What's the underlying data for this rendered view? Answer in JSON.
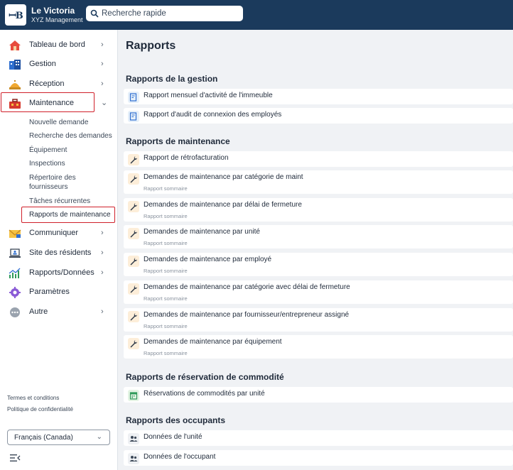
{
  "header": {
    "logo_text": "ꟷB",
    "brand_title": "Le Victoria",
    "brand_subtitle": "XYZ Management",
    "search_placeholder": "Recherche rapide"
  },
  "sidebar": {
    "items": [
      {
        "label": "Tableau de bord",
        "icon": "house-icon"
      },
      {
        "label": "Gestion",
        "icon": "building-icon"
      },
      {
        "label": "Réception",
        "icon": "service-bell-icon"
      },
      {
        "label": "Maintenance",
        "icon": "toolbox-icon"
      },
      {
        "label": "Communiquer",
        "icon": "envelope-icon"
      },
      {
        "label": "Site des résidents",
        "icon": "laptop-icon"
      },
      {
        "label": "Rapports/Données",
        "icon": "chart-icon"
      },
      {
        "label": "Paramètres",
        "icon": "gear-icon"
      },
      {
        "label": "Autre",
        "icon": "more-icon"
      }
    ],
    "maintenance_sub": [
      "Nouvelle demande",
      "Recherche des demandes",
      "Équipement",
      "Inspections",
      "Répertoire des fournisseurs",
      "Tâches récurrentes",
      "Rapports de maintenance"
    ],
    "footer": {
      "terms": "Termes et conditions",
      "privacy": "Politique de confidentialité",
      "language": "Français (Canada)"
    }
  },
  "main": {
    "title": "Rapports",
    "sections": [
      {
        "title": "Rapports de la gestion"
      },
      {
        "title": "Rapports de maintenance"
      },
      {
        "title": "Rapports de réservation de commodité"
      },
      {
        "title": "Rapports des occupants"
      }
    ],
    "reports": {
      "gestion": [
        "Rapport mensuel d'activité de l'immeuble",
        "Rapport d'audit de connexion des employés"
      ],
      "maintenance": [
        {
          "label": "Rapport de rétrofacturation",
          "sub": ""
        },
        {
          "label": "Demandes de maintenance par catégorie de maint",
          "sub": "Rapport sommaire"
        },
        {
          "label": "Demandes de maintenance par délai de fermeture",
          "sub": "Rapport sommaire"
        },
        {
          "label": "Demandes de maintenance par unité",
          "sub": "Rapport sommaire"
        },
        {
          "label": "Demandes de maintenance par employé",
          "sub": "Rapport sommaire"
        },
        {
          "label": "Demandes de maintenance par catégorie avec délai de fermeture",
          "sub": "Rapport sommaire"
        },
        {
          "label": "Demandes de maintenance par fournisseur/entrepreneur assigné",
          "sub": "Rapport sommaire"
        },
        {
          "label": "Demandes de maintenance par équipement",
          "sub": "Rapport sommaire"
        }
      ],
      "reservation": [
        "Réservations de commodités par unité"
      ],
      "occupants": [
        "Données de l'unité",
        "Données de l'occupant"
      ]
    }
  },
  "colors": {
    "topbar": "#1b3a5c",
    "highlight": "#d0202a"
  }
}
